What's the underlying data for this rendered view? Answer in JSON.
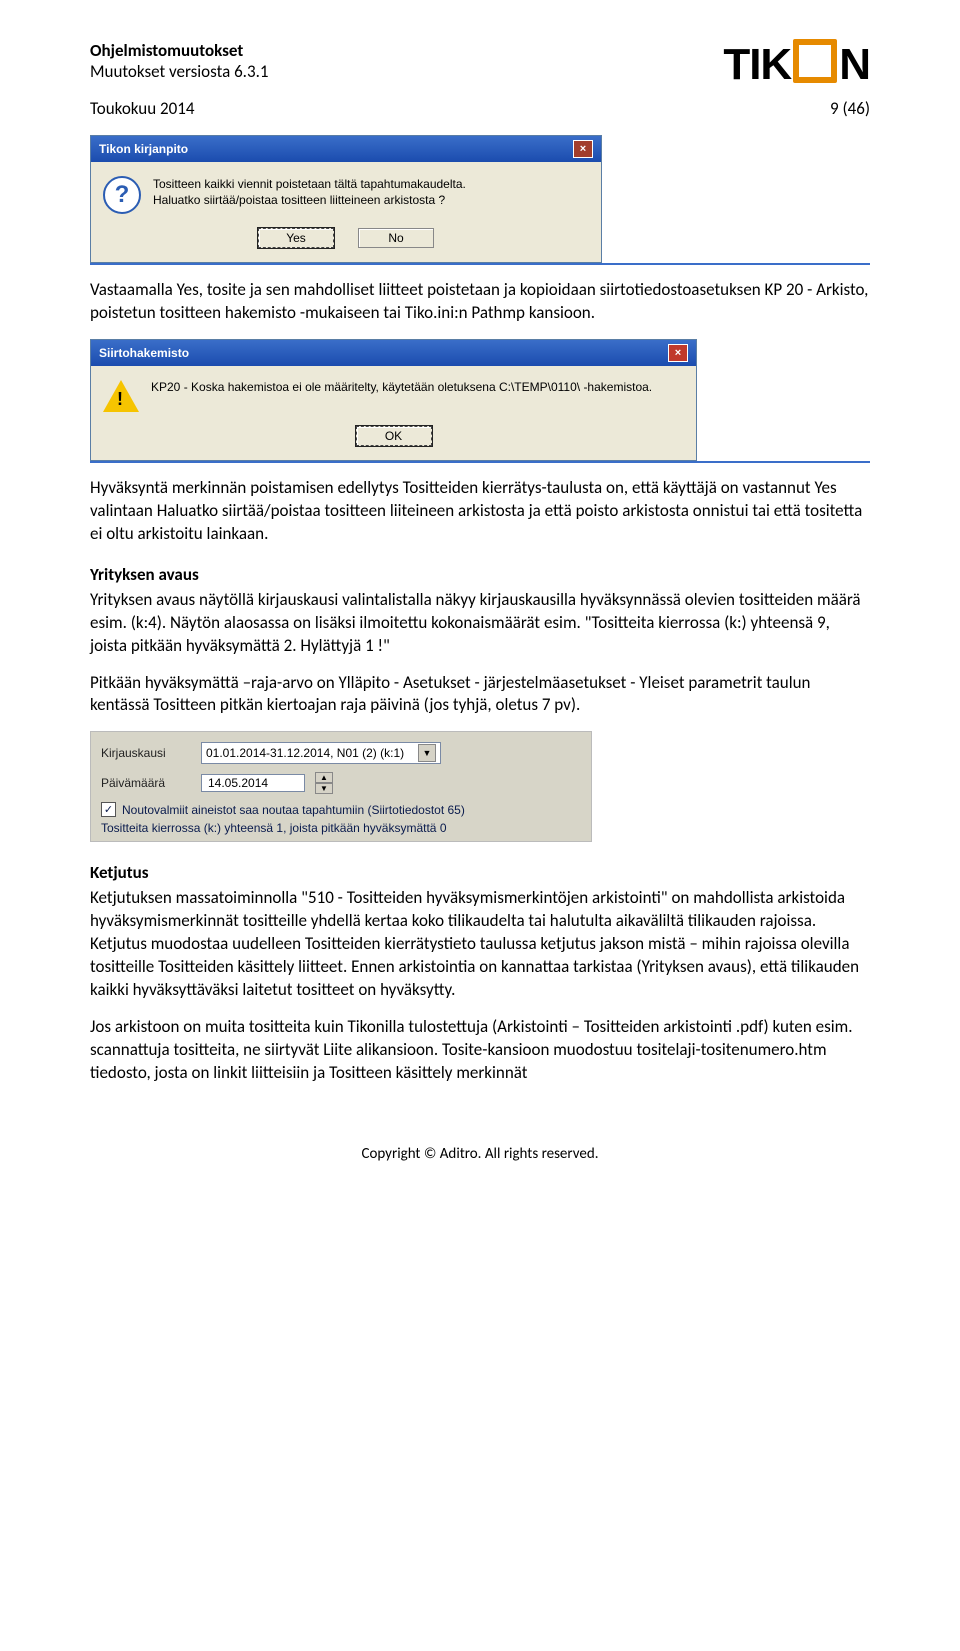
{
  "header": {
    "title": "Ohjelmistomuutokset",
    "subtitle": "Muutokset versiosta 6.3.1",
    "logo_text_pre": "TIK",
    "logo_text_post": "N"
  },
  "date_row": {
    "left": "Toukokuu 2014",
    "right": "9 (46)"
  },
  "dialog1": {
    "title": "Tikon kirjanpito",
    "line1": "Tositteen kaikki viennit poistetaan tältä tapahtumakaudelta.",
    "line2": "Haluatko siirtää/poistaa tositteen liitteineen arkistosta ?",
    "yes": "Yes",
    "no": "No"
  },
  "para1": "Vastaamalla Yes, tosite ja sen mahdolliset liitteet poistetaan ja kopioidaan siirtotiedostoasetuksen KP 20 - Arkisto, poistetun tositteen hakemisto -mukaiseen tai  Tiko.ini:n Pathmp kansioon.",
  "dialog2": {
    "title": "Siirtohakemisto",
    "msg": "KP20 - Koska hakemistoa ei ole määritelty, käytetään oletuksena C:\\TEMP\\0110\\ -hakemistoa.",
    "ok": "OK"
  },
  "para2": "Hyväksyntä merkinnän poistamisen edellytys Tositteiden kierrätys-taulusta on, että käyttäjä on vastannut Yes valintaan Haluatko siirtää/poistaa tositteen liiteineen arkistosta ja että poisto arkistosta onnistui tai että tositetta ei oltu arkistoitu lainkaan.",
  "h_yritys": "Yrityksen avaus",
  "para3": "Yrityksen avaus näytöllä kirjauskausi valintalistalla näkyy kirjauskausilla hyväksynnässä olevien tositteiden määrä esim. (k:4). Näytön alaosassa on lisäksi ilmoitettu kokonaismäärät  esim. \"Tositteita kierrossa (k:) yhteensä 9, joista pitkään hyväksymättä 2. Hylättyjä 1 !\"",
  "para4": "Pitkään hyväksymättä –raja-arvo on Ylläpito - Asetukset - järjestelmäasetukset - Yleiset parametrit taulun kentässä Tositteen pitkän kiertoajan raja päivinä (jos tyhjä, oletus 7 pv).",
  "form": {
    "label_kausi": "Kirjauskausi",
    "combo_value": "01.01.2014-31.12.2014, N01 (2) (k:1)",
    "label_pvm": "Päivämäärä",
    "date_value": "14.05.2014",
    "check_label": "Noutovalmiit aineistot saa noutaa tapahtumiin (Siirtotiedostot 65)",
    "status": "Tositteita kierrossa (k:) yhteensä 1, joista pitkään hyväksymättä 0"
  },
  "h_ketjutus": "Ketjutus",
  "para5": "Ketjutuksen massatoiminnolla \"510 - Tositteiden hyväksymismerkintöjen arkistointi\" on mahdollista arkistoida hyväksymismerkinnät tositteille yhdellä kertaa koko tilikaudelta tai halutulta aikaväliltä tilikauden rajoissa. Ketjutus muodostaa uudelleen Tositteiden kierrätystieto taulussa ketjutus jakson mistä – mihin rajoissa olevilla tositteille Tositteiden käsittely liitteet. Ennen arkistointia on kannattaa tarkistaa (Yrityksen avaus), että tilikauden kaikki hyväksyttäväksi laitetut tositteet on hyväksytty.",
  "para6": "Jos arkistoon on muita tositteita kuin Tikonilla tulostettuja (Arkistointi – Tositteiden arkistointi .pdf) kuten esim. scannattuja tositteita, ne siirtyvät Liite alikansioon. Tosite-kansioon muodostuu tositelaji-tositenumero.htm tiedosto, josta on linkit liitteisiin ja Tositteen käsittely merkinnät",
  "footer": "Copyright © Aditro. All rights reserved."
}
